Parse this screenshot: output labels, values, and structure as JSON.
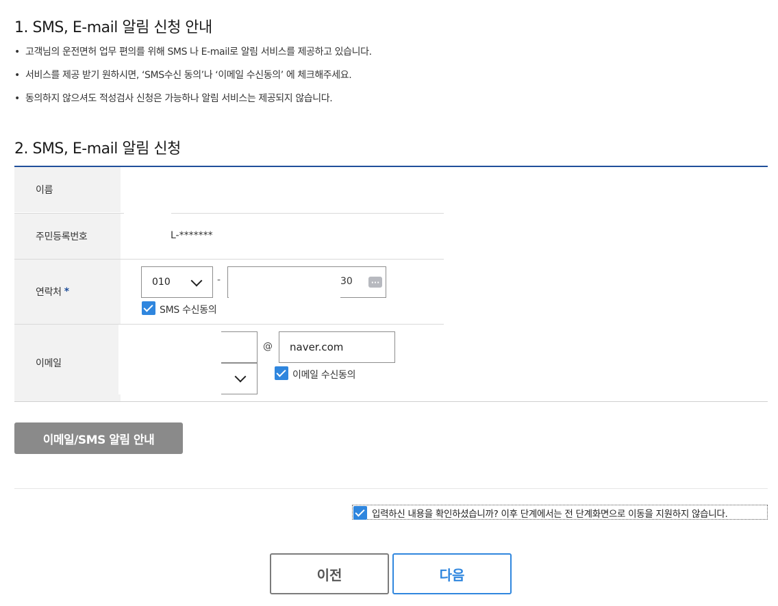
{
  "section1": {
    "title": "1. SMS, E-mail 알림 신청 안내",
    "bullets": [
      "고객님의 운전면허 업무 편의를 위해 SMS 나 E-mail로 알림 서비스를 제공하고 있습니다.",
      "서비스를 제공 받기 원하시면, ‘SMS수신 동의’나 ‘이메일 수신동의’ 에 체크해주세요.",
      "동의하지 않으셔도 적성검사 신청은 가능하나 알림 서비스는 제공되지 않습니다."
    ]
  },
  "section2": {
    "title": "2. SMS, E-mail 알림 신청",
    "labels": {
      "name": "이름",
      "rrn": "주민등록번호",
      "phone": "연락처",
      "email": "이메일"
    },
    "required_mark": "*",
    "rrn_value": "L-*******",
    "phone": {
      "prefix": "010",
      "dash": "-",
      "tail_visible": "30",
      "sms_consent_label": "SMS 수신동의",
      "sms_consent_checked": true
    },
    "email": {
      "at": "@",
      "domain": "naver.com",
      "consent_label": "이메일 수신동의",
      "consent_checked": true
    }
  },
  "guide_button": "이메일/SMS 알림 안내",
  "confirm": {
    "label": "입력하신 내용을 확인하셨습니까? 이후 단계에서는 전 단계화면으로 이동을 지원하지 않습니다.",
    "checked": true
  },
  "nav": {
    "prev": "이전",
    "next": "다음"
  },
  "colors": {
    "accent": "#2f86de",
    "title_line": "#1f4e9a",
    "grey_button": "#8a8a8a"
  },
  "icons": {
    "select_arrow": "chevron-down-icon",
    "keypad": "keypad-icon",
    "checkbox": "check-icon"
  }
}
